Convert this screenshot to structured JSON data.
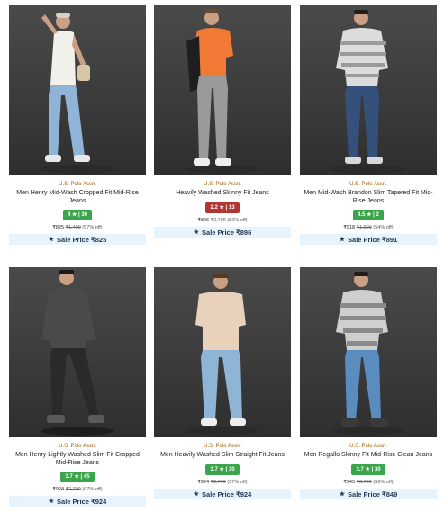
{
  "products": [
    {
      "brand": "U.S. Polo Assn.",
      "title": "Men Henry Mid-Wash Cropped Fit Mid-Rise Jeans",
      "rating": "4 ★ | 30",
      "rating_color": "#3aa54a",
      "price": "₹825",
      "mrp": "₹1,499",
      "discount": "(57% off)",
      "sale_label": "Sale Price ₹825",
      "image": "model-white-tank-light-jeans"
    },
    {
      "brand": "U.S. Polo Assn.",
      "title": "Heavily Washed Skinny Fit Jeans",
      "rating": "2.2 ★ | 13",
      "rating_color": "#b13634",
      "price": "₹896",
      "mrp": "₹2,799",
      "discount": "(52% off)",
      "sale_label": "Sale Price ₹896",
      "image": "model-orange-tee-grey-jeans"
    },
    {
      "brand": "U.S. Polo Assn.",
      "title": "Men Mid-Wash Brandon Slim Tapered Fit Mid-Rise Jeans",
      "rating": "4.5 ★ | 2",
      "rating_color": "#3aa54a",
      "price": "₹918",
      "mrp": "₹1,999",
      "discount": "(54% off)",
      "sale_label": "Sale Price ₹891",
      "image": "model-striped-polo-dark-jeans"
    },
    {
      "brand": "U.S. Polo Assn.",
      "title": "Men Henry Lightly Washed Slim Fit Cropped Mid-Rise Jeans",
      "rating": "3.7 ★ | 45",
      "rating_color": "#3aa54a",
      "price": "₹924",
      "mrp": "₹2,799",
      "discount": "(67% off)",
      "sale_label": "Sale Price ₹924",
      "image": "model-grey-sweater-black-jeans"
    },
    {
      "brand": "U.S. Polo Assn.",
      "title": "Men Heavily Washed Slim Straight Fit Jeans",
      "rating": "3.7 ★ | 30",
      "rating_color": "#3aa54a",
      "price": "₹924",
      "mrp": "₹2,799",
      "discount": "(67% off)",
      "sale_label": "Sale Price ₹924",
      "image": "model-beige-tee-light-jeans"
    },
    {
      "brand": "U.S. Polo Assn.",
      "title": "Men Regallo Skinny Fit Mid-Rise Clean Jeans",
      "rating": "3.7 ★ | 30",
      "rating_color": "#3aa54a",
      "price": "₹945",
      "mrp": "₹2,799",
      "discount": "(66% off)",
      "sale_label": "Sale Price ₹849",
      "image": "model-striped-polo-blue-jeans"
    }
  ]
}
